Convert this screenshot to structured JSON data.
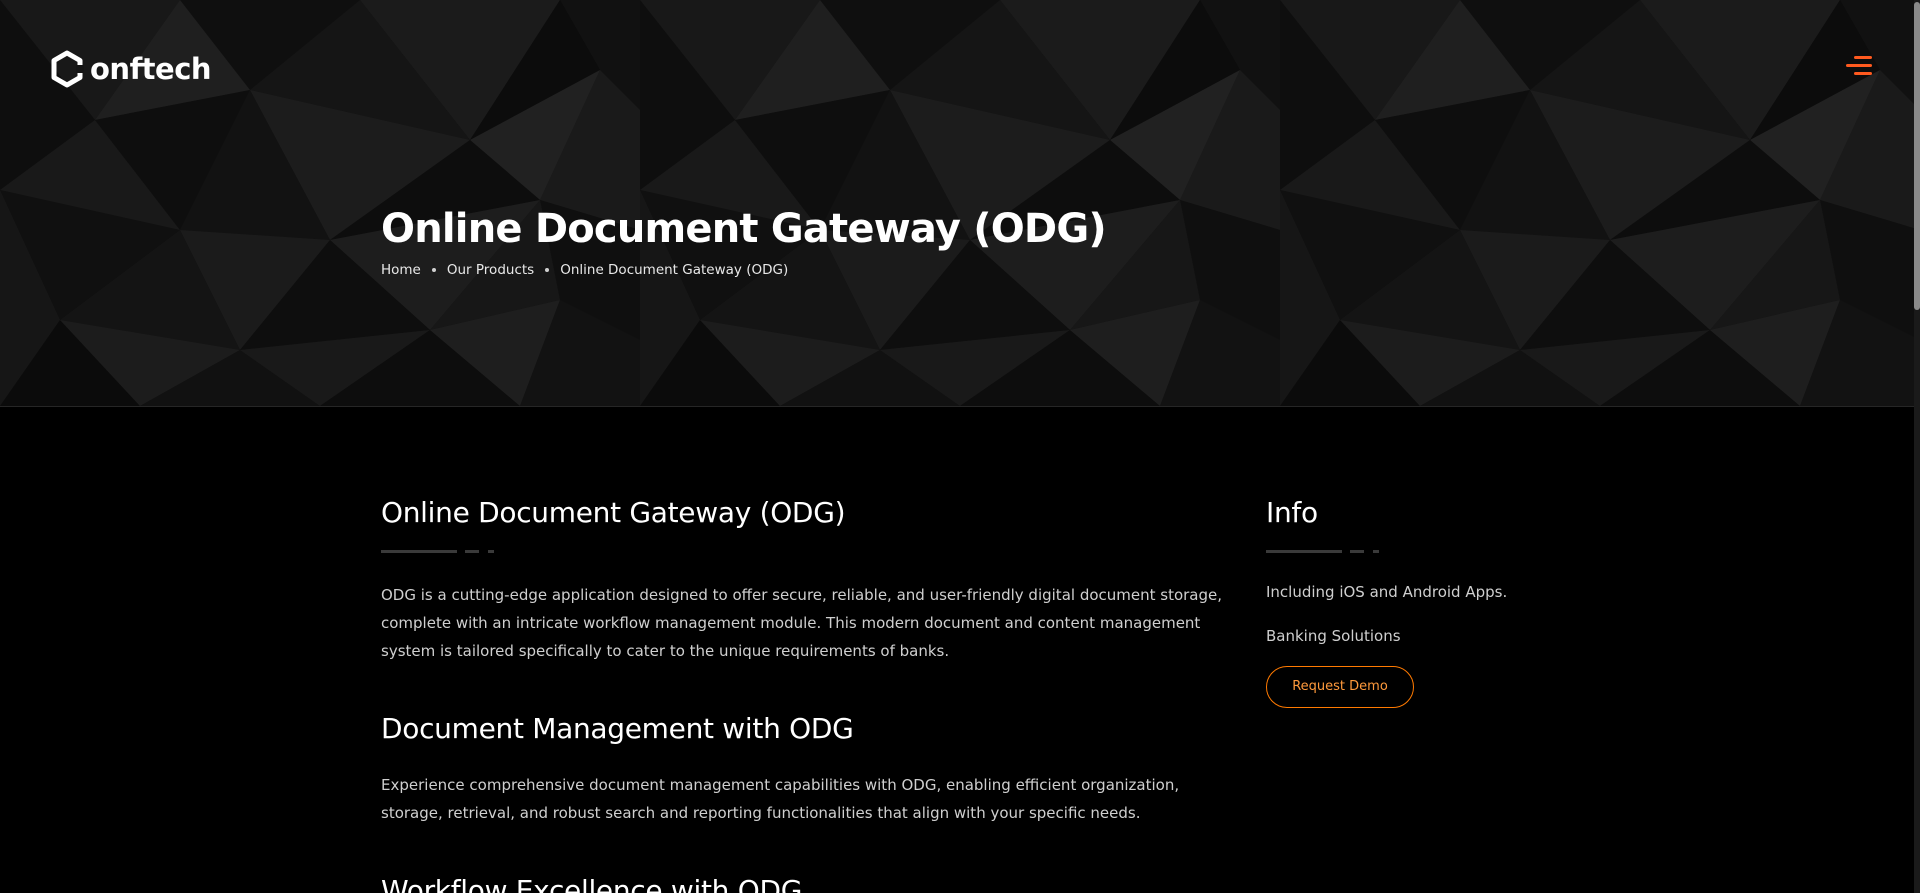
{
  "header": {
    "logo_text": "onftech",
    "menu_icon": "hamburger-menu-icon"
  },
  "hero": {
    "title": "Online Document Gateway (ODG)",
    "breadcrumb": [
      "Home",
      "Our Products",
      "Online Document Gateway (ODG)"
    ]
  },
  "main": {
    "heading": "Online Document Gateway (ODG)",
    "intro": "ODG is a cutting-edge application designed to offer secure, reliable, and user-friendly digital document storage, complete with an intricate workflow management module. This modern document and content management system is tailored specifically to cater to the unique requirements of banks.",
    "sections": [
      {
        "title": "Document Management with ODG",
        "text": "Experience comprehensive document management capabilities with ODG, enabling efficient organization, storage, retrieval, and robust search and reporting functionalities that align with your specific needs."
      },
      {
        "title": "Workflow Excellence with ODG",
        "text": ""
      }
    ]
  },
  "sidebar": {
    "heading": "Info",
    "lines": [
      "Including iOS and Android Apps.",
      "Banking Solutions"
    ],
    "demo_button": "Request Demo"
  },
  "colors": {
    "accent": "#ff5a1f",
    "button_border": "#ff7a00",
    "background": "#000000",
    "hero_background": "#151515",
    "body_text": "#cfcfcf"
  }
}
